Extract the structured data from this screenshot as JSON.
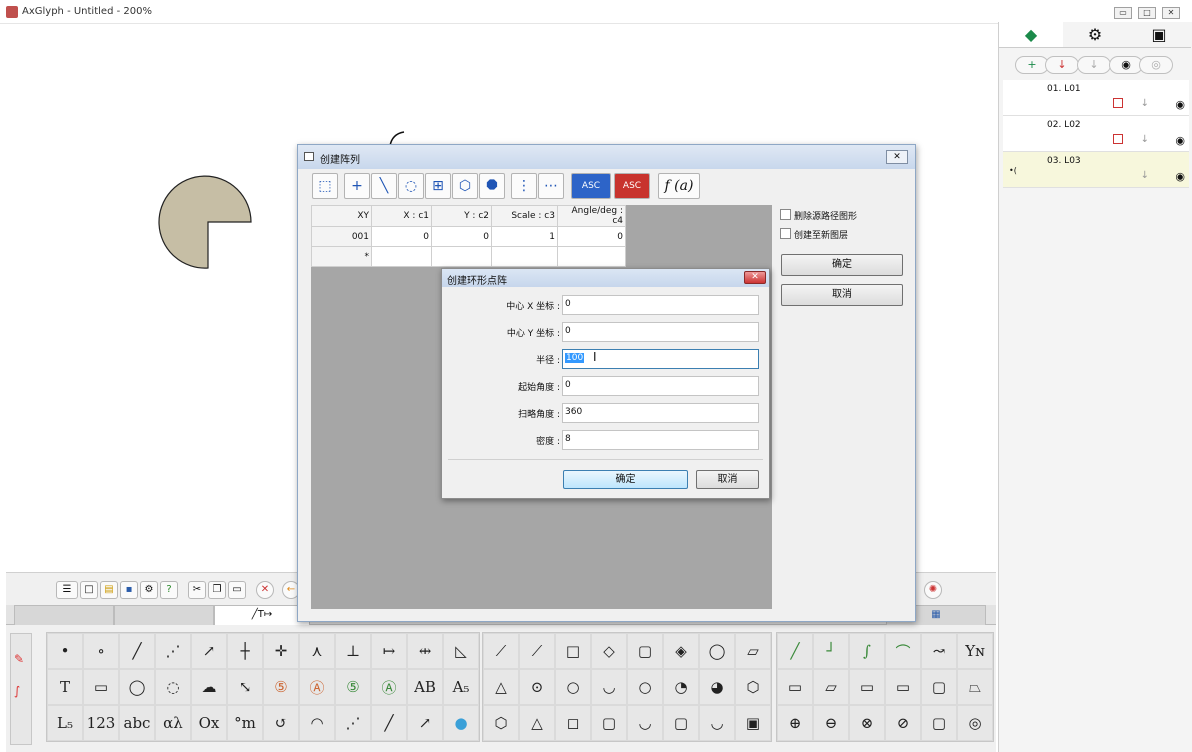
{
  "app": {
    "title": "AxGlyph - Untitled - 200%"
  },
  "window_controls": {
    "minimize": "▭",
    "maximize": "□",
    "close": "✕"
  },
  "right_panel": {
    "tabs": [
      "layers-icon",
      "palette-icon",
      "camera-icon"
    ],
    "layers": [
      {
        "name": "01. L01"
      },
      {
        "name": "02. L02"
      },
      {
        "name": "03. L03"
      }
    ]
  },
  "bottom_tabs": [
    "",
    "",
    "╱T↦"
  ],
  "array_dialog": {
    "title": "创建阵列",
    "table": {
      "headers": [
        "XY",
        "X : c1",
        "Y : c2",
        "Scale : c3",
        "Angle/deg : c4"
      ],
      "rows": [
        [
          "001",
          "0",
          "0",
          "1",
          "0"
        ],
        [
          "*",
          "",
          "",
          "",
          ""
        ]
      ]
    },
    "option_delete": "删除源路径图形",
    "option_new_layer": "创建至新图层",
    "ok": "确定",
    "cancel": "取消",
    "toolbar_func": "f (a)"
  },
  "ring_dialog": {
    "title": "创建环形点阵",
    "close": "✕",
    "fields": [
      {
        "label": "中心 X 坐标 :",
        "value": "0"
      },
      {
        "label": "中心 Y 坐标 :",
        "value": "0"
      },
      {
        "label": "半径 :",
        "value": "100"
      },
      {
        "label": "起始角度 :",
        "value": "0"
      },
      {
        "label": "扫略角度 :",
        "value": "360"
      },
      {
        "label": "密度 :",
        "value": "8"
      }
    ],
    "ok": "确定",
    "cancel": "取消"
  },
  "shape_colors": {
    "pacman_fill": "#c6bea5",
    "pacman_stroke": "#222222"
  }
}
